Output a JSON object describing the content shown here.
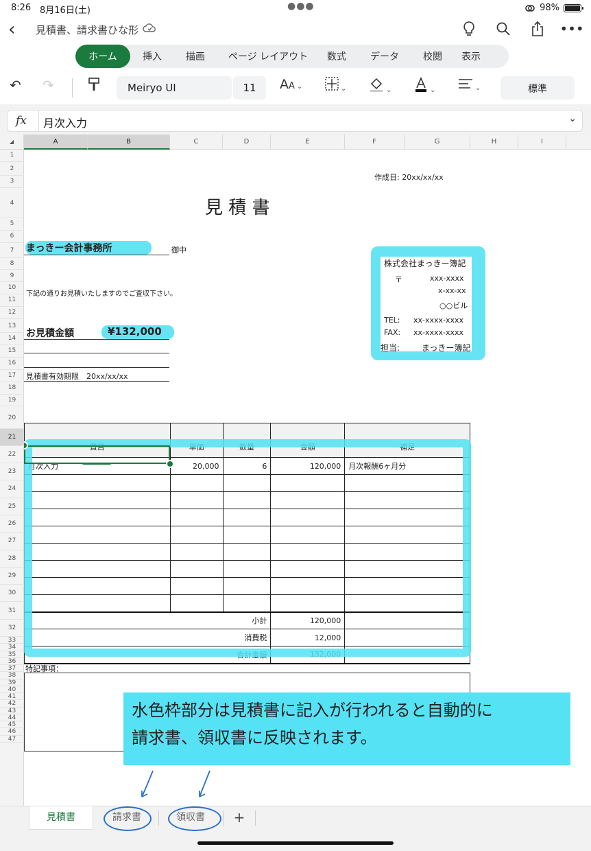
{
  "status": {
    "time": "8:26",
    "date": "8月16日(土)",
    "battery": "98%"
  },
  "title": {
    "doc_name": "見積書、請求書ひな形"
  },
  "ribbon": {
    "tabs": [
      "ホーム",
      "挿入",
      "描画",
      "ページ レイアウト",
      "数式",
      "データ",
      "校閲",
      "表示"
    ],
    "active": "ホーム"
  },
  "toolbar": {
    "font": "Meiryo UI",
    "size": "11",
    "format": "標準"
  },
  "formula_bar": {
    "fx": "fx",
    "value": "月次入力"
  },
  "columns": [
    "A",
    "B",
    "C",
    "D",
    "E",
    "F",
    "G",
    "H",
    "I"
  ],
  "rows": [
    "1",
    "2",
    "3",
    "4",
    "5",
    "6",
    "7",
    "8",
    "9",
    "10",
    "11",
    "12",
    "13",
    "14",
    "15",
    "16",
    "17",
    "18",
    "19",
    "20",
    "21",
    "22",
    "23",
    "24",
    "25",
    "26",
    "27",
    "28",
    "29",
    "30",
    "31",
    "32",
    "33",
    "34",
    "35",
    "36",
    "37",
    "38",
    "39",
    "40",
    "41",
    "42",
    "43",
    "44",
    "45",
    "46",
    "47"
  ],
  "sheet": {
    "created_date": "作成日: 20xx/xx/xx",
    "doc_title": "見 積 書",
    "client": "まっきー会計事務所",
    "honorific": "御中",
    "greeting": "下記の通りお見積いたしますのでご査収下さい。",
    "amount_label": "お見積金額",
    "amount_value": "¥132,000",
    "validity": "見積書有効期限　20xx/xx/xx",
    "company": {
      "name": "株式会社まっきー簿記",
      "postal_mark": "〒",
      "postal": "xxx-xxxx",
      "address1": "x-xx-xx",
      "address2": "○○ビル",
      "tel_label": "TEL:",
      "tel": "xx-xxxx-xxxx",
      "fax_label": "FAX:",
      "fax": "xx-xxxx-xxxx",
      "person_label": "担当:",
      "person": "まっきー簿記"
    },
    "table": {
      "headers": [
        "費目",
        "単価",
        "数量",
        "金額",
        "補足"
      ],
      "rows": [
        [
          "月次入力",
          "20,000",
          "6",
          "120,000",
          "月次報酬6ヶ月分"
        ],
        [
          "",
          "",
          "",
          "",
          ""
        ],
        [
          "",
          "",
          "",
          "",
          ""
        ],
        [
          "",
          "",
          "",
          "",
          ""
        ],
        [
          "",
          "",
          "",
          "",
          ""
        ],
        [
          "",
          "",
          "",
          "",
          ""
        ],
        [
          "",
          "",
          "",
          "",
          ""
        ],
        [
          "",
          "",
          "",
          "",
          ""
        ],
        [
          "",
          "",
          "",
          "",
          ""
        ]
      ],
      "subtotal_label": "小計",
      "subtotal": "120,000",
      "tax_label": "消費税",
      "tax": "12,000",
      "total_label": "合計金額",
      "total": "132,000"
    },
    "notes_label": "特記事項："
  },
  "callout": {
    "line1": "水色枠部分は見積書に記入が行われると自動的に",
    "line2": "請求書、領収書に反映されます。"
  },
  "sheet_tabs": [
    "見積書",
    "請求書",
    "領収書"
  ],
  "add_sheet": "+",
  "colors": {
    "accent": "#1b7a3e",
    "highlight": "#56e2f5",
    "annotation": "#2a6fcf"
  }
}
